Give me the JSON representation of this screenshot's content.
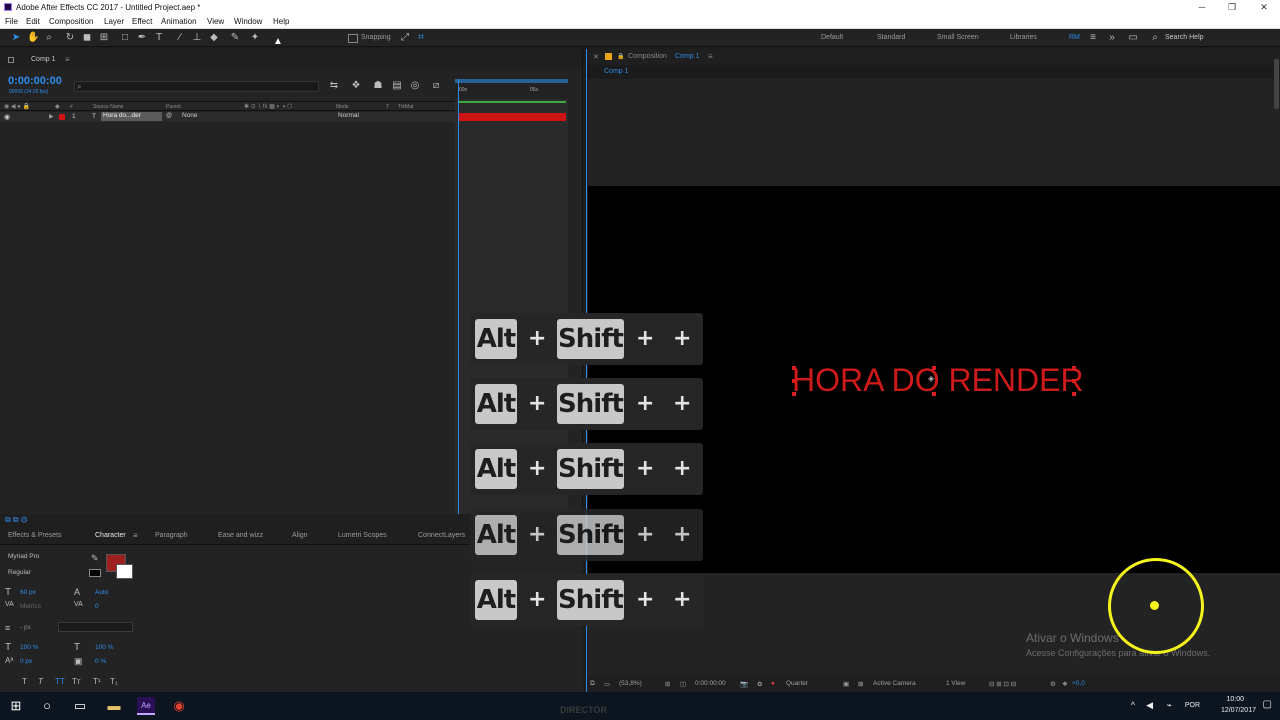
{
  "window": {
    "title": "Adobe After Effects CC 2017 - Untitled Project.aep *"
  },
  "menu": [
    "File",
    "Edit",
    "Composition",
    "Layer",
    "Effect",
    "Animation",
    "View",
    "Window",
    "Help"
  ],
  "toolbar": {
    "snapping_label": "Snapping",
    "workspaces": [
      "Default",
      "Standard",
      "Small Screen",
      "Libraries",
      "RM"
    ],
    "search_placeholder": "Search Help"
  },
  "timeline": {
    "tab": "Comp 1",
    "timecode": "0:00:00:00",
    "fps": "00000 (24.00 fps)",
    "columns": {
      "source_name": "Source Name",
      "parent": "Parent",
      "mode": "Mode",
      "t": "T",
      "trkmat": "TrkMat"
    },
    "ruler": {
      "start": "00s",
      "mark": "05s"
    },
    "layer": {
      "index": "1",
      "type_icon": "T",
      "name": "Hora do...der",
      "parent": "None",
      "mode": "Normal"
    }
  },
  "bottom_tabs": [
    "Effects & Presets",
    "Character",
    "Paragraph",
    "Ease and wizz",
    "Align",
    "Lumetri Scopes",
    "ConnectLayers"
  ],
  "character": {
    "font": "Myriad Pro",
    "style": "Regular",
    "size": "60 px",
    "leading": "Auto",
    "kerning": "Metrics",
    "tracking": "0",
    "stroke_width": "- px",
    "vertical_scale": "100 %",
    "horizontal_scale": "100 %",
    "baseline_shift": "0 px",
    "tsume": "0 %",
    "fill_color": "#9e2020",
    "styles": [
      "T",
      "T",
      "TT",
      "Tт",
      "T¹",
      "T₁"
    ]
  },
  "viewer": {
    "header": "Composition",
    "comp_name": "Comp 1",
    "breadcrumb": "Comp 1",
    "comp_text": "HORA DO RENDER",
    "text_color": "#cf1a1a",
    "footer": {
      "zoom": "(53,8%)",
      "time": "0:00:00:00",
      "resolution": "Quarter",
      "camera": "Active Camera",
      "views": "1 View",
      "exposure": "+0,0"
    }
  },
  "keystroke_overlay": [
    {
      "key1": "Alt",
      "plus": "+",
      "key2": "Shift",
      "plus2": "+",
      "plus3": "+"
    },
    {
      "key1": "Alt",
      "plus": "+",
      "key2": "Shift",
      "plus2": "+",
      "plus3": "+"
    },
    {
      "key1": "Alt",
      "plus": "+",
      "key2": "Shift",
      "plus2": "+",
      "plus3": "+"
    },
    {
      "key1": "Alt",
      "plus": "+",
      "key2": "Shift",
      "plus2": "+",
      "plus3": "+"
    },
    {
      "key1": "Alt",
      "plus": "+",
      "key2": "Shift",
      "plus2": "+",
      "plus3": "+"
    }
  ],
  "watermark": {
    "line1": "Ativar o Windows",
    "line2": "Acesse Configurações para ativar o Windows."
  },
  "taskbar": {
    "language": "POR",
    "time": "10:00",
    "date": "12/07/2017",
    "background_text": "DIRECTOR"
  },
  "colors": {
    "accent": "#2d8ceb",
    "cursor_highlight": "#f5f51c",
    "layer_label": "#cc1414"
  }
}
